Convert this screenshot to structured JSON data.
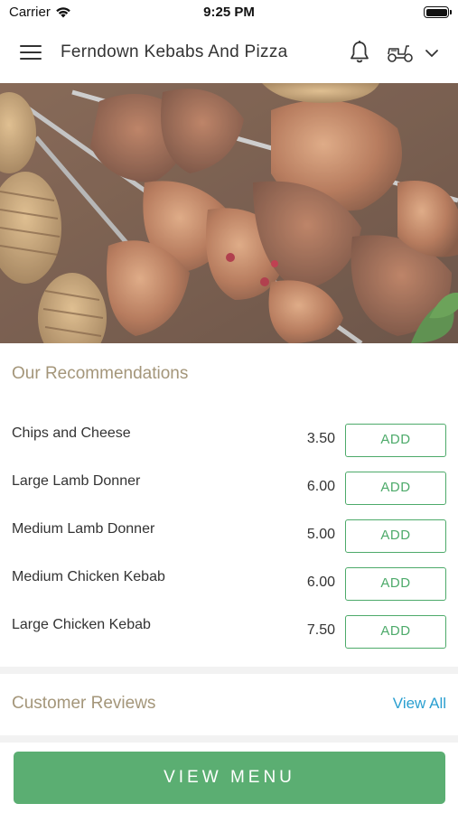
{
  "status_bar": {
    "carrier": "Carrier",
    "time": "9:25 PM"
  },
  "header": {
    "title": "Ferndown Kebabs And Pizza",
    "icons": [
      "menu-icon",
      "bell-icon",
      "scooter-icon",
      "chevron-down-icon"
    ]
  },
  "hero": {
    "subject": "grilled kebab skewers",
    "icon": "hero-image"
  },
  "recommendations": {
    "title": "Our Recommendations",
    "add_label": "ADD",
    "items": [
      {
        "name": "Chips and Cheese",
        "price": "3.50"
      },
      {
        "name": "Large Lamb Donner",
        "price": "6.00"
      },
      {
        "name": "Medium Lamb Donner",
        "price": "5.00"
      },
      {
        "name": "Medium Chicken Kebab",
        "price": "6.00"
      },
      {
        "name": "Large Chicken Kebab",
        "price": "7.50"
      }
    ]
  },
  "reviews": {
    "title": "Customer Reviews",
    "view_all": "View All"
  },
  "bottom": {
    "view_menu": "VIEW MENU"
  },
  "colors": {
    "accent_green": "#5bae72",
    "add_green": "#4daa6a",
    "section_title": "#a4967a",
    "link_blue": "#2a9fd0"
  }
}
